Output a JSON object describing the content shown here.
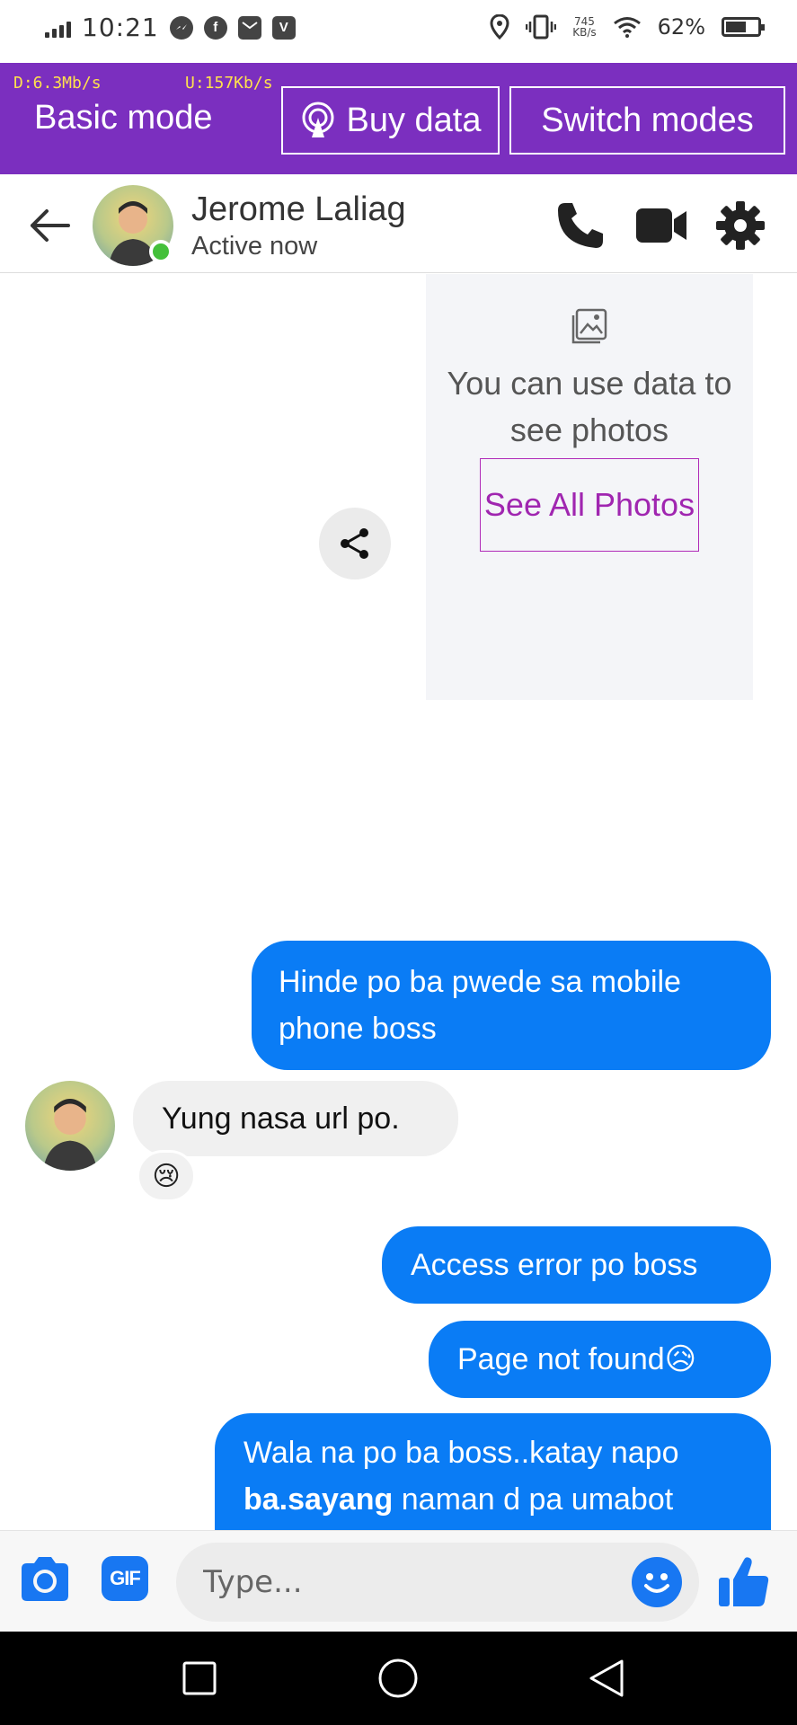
{
  "status_bar": {
    "time": "10:21",
    "network_speed_value": "745",
    "network_speed_unit": "KB/s",
    "battery_percent": "62%",
    "battery_level": 0.62,
    "notification_icons": [
      "messenger-icon",
      "facebook-icon",
      "mail-icon",
      "vivo-icon"
    ],
    "system_icons": [
      "location-icon",
      "vibrate-icon",
      "wifi-icon",
      "battery-icon"
    ]
  },
  "mode_bar": {
    "download_speed": "D:6.3Mb/s",
    "upload_speed": "U:157Kb/s",
    "mode_label": "Basic mode",
    "buy_data_label": "Buy data",
    "switch_modes_label": "Switch modes",
    "background_color": "#7b2fbf"
  },
  "header": {
    "contact_name": "Jerome Laliag",
    "status": "Active now",
    "online_color": "#44c03a"
  },
  "photo_card": {
    "note": "You can use data to see photos",
    "see_all_label": "See All Photos"
  },
  "messages": [
    {
      "direction": "outgoing",
      "text": "Hinde po ba pwede sa mobile phone boss"
    },
    {
      "direction": "incoming",
      "text": "Yung nasa url po.",
      "reaction": "😢"
    },
    {
      "direction": "outgoing",
      "text": "Access error po boss"
    },
    {
      "direction": "outgoing",
      "text": "Page not found😥"
    },
    {
      "direction": "outgoing",
      "text_part1": "Wala na po ba boss..katay napo ",
      "text_bold": "ba.sayang",
      "text_part2": " naman d pa umabot"
    }
  ],
  "composer": {
    "gif_label": "GIF",
    "placeholder": "Type..."
  },
  "colors": {
    "messenger_blue": "#0a7cf5",
    "accent_blue": "#1877f2",
    "see_all_purple": "#a026b0"
  }
}
